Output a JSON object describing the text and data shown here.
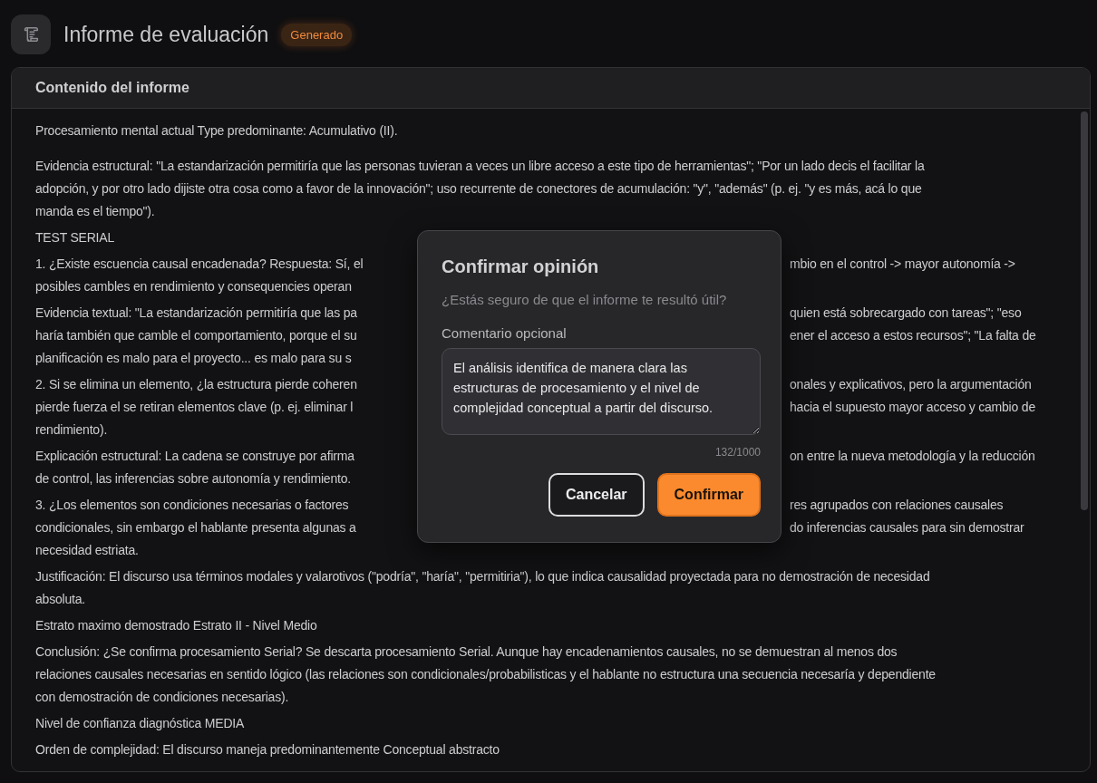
{
  "header": {
    "title": "Informe de evaluación",
    "badge": "Generado"
  },
  "panel": {
    "title": "Contenido del informe",
    "paragraphs": [
      {
        "lines": [
          {
            "kind": "full",
            "text": "Procesamiento mental actual Type predominante: Acumulativo (II)."
          }
        ]
      },
      {
        "lines": [
          {
            "kind": "full",
            "text": "Evidencia estructural: \"La estandarización permitiría que las personas tuvieran a veces un libre acceso a este tipo de herramientas\"; \"Por un lado decis el facilitar la"
          },
          {
            "kind": "full",
            "text": "adopción, y por otro lado dijiste otra cosa como a favor de la innovación\"; uso recurrente de conectores de acumulación: \"y\", \"además\" (p. ej. \"y es más, acá lo que"
          },
          {
            "kind": "full",
            "text": "manda es el tiempo\")."
          }
        ]
      },
      {
        "lines": [
          {
            "kind": "full",
            "text": "TEST SERIAL"
          }
        ]
      },
      {
        "lines": [
          {
            "kind": "split",
            "left": "1. ¿Existe escuencia causal encadenada? Respuesta: Sí, el",
            "right": "mbio en el control -> mayor autonomía ->"
          },
          {
            "kind": "split",
            "left": "posibles cambles en rendimiento y consequencies operan"
          }
        ]
      },
      {
        "lines": [
          {
            "kind": "split",
            "left": "Evidencia textual: \"La estandarización permitiría que las pa",
            "right": "quien está sobrecargado con tareas\"; \"eso"
          },
          {
            "kind": "split",
            "left": "haría también que camble el comportamiento, porque el su",
            "right": "ener el acceso a estos recursos\"; \"La falta de"
          },
          {
            "kind": "split",
            "left": "planificación es malo para el proyecto... es malo para su s"
          }
        ]
      },
      {
        "lines": [
          {
            "kind": "split",
            "left": "2. Si se elimina un elemento, ¿la estructura pierde coheren",
            "right": "onales y explicativos, pero la argumentación"
          },
          {
            "kind": "split",
            "left": "pierde fuerza el se retiran elementos clave (p. ej. eliminar l",
            "right": "hacia el supuesto mayor acceso y cambio de"
          },
          {
            "kind": "full",
            "text": "rendimiento)."
          }
        ]
      },
      {
        "lines": [
          {
            "kind": "split",
            "left": "Explicación estructural: La cadena se construye por afirma",
            "right": "on entre la nueva metodología y la reducción"
          },
          {
            "kind": "full",
            "text": "de control, las inferencias sobre autonomía y rendimiento."
          }
        ]
      },
      {
        "lines": [
          {
            "kind": "split",
            "left": "3. ¿Los elementos son condiciones necesarias o factores",
            "right": "res agrupados con relaciones causales"
          },
          {
            "kind": "split",
            "left": "condicionales, sin embargo el hablante presenta algunas a",
            "right": "do inferencias causales para sin demostrar"
          },
          {
            "kind": "full",
            "text": "necesidad estriata."
          }
        ]
      },
      {
        "lines": [
          {
            "kind": "full",
            "text": "Justificación: El discurso usa términos modales y valarotivos (\"podría\", \"haría\", \"permitiria\"), lo que indica causalidad proyectada para no demostración de necesidad"
          },
          {
            "kind": "full",
            "text": "absoluta."
          }
        ]
      },
      {
        "lines": [
          {
            "kind": "full",
            "text": "Estrato maximo demostrado Estrato II - Nivel Medio"
          }
        ]
      },
      {
        "lines": [
          {
            "kind": "full",
            "text": "Conclusión: ¿Se confirma procesamiento Serial? Se descarta procesamiento Serial. Aunque hay encadenamientos causales, no se demuestran al menos dos"
          },
          {
            "kind": "full",
            "text": "relaciones causales necesarias en sentido lógico (las relaciones son condicionales/probabilisticas y el hablante no estructura una secuencia necesaría y dependiente"
          },
          {
            "kind": "full",
            "text": "con demostración de condiciones necesarias)."
          }
        ]
      },
      {
        "lines": [
          {
            "kind": "full",
            "text": "Nivel de confianza diagnóstica MEDIA"
          }
        ]
      },
      {
        "lines": [
          {
            "kind": "full",
            "text": "Orden de complejidad: El discurso maneja predominantemente Conceptual abstracto"
          }
        ]
      }
    ]
  },
  "dialog": {
    "title": "Confirmar opinión",
    "question": "¿Estás seguro de que el informe te resultó útil?",
    "comment_label": "Comentario opcional",
    "comment_value": "El análisis identifica de manera clara las estructuras de procesamiento y el nivel de complejidad conceptual a partir del discurso.",
    "counter": "132/1000",
    "buttons": [
      {
        "label": "Cancelar",
        "kind": "secondary"
      },
      {
        "label": "Confirmar",
        "kind": "primary"
      }
    ]
  }
}
